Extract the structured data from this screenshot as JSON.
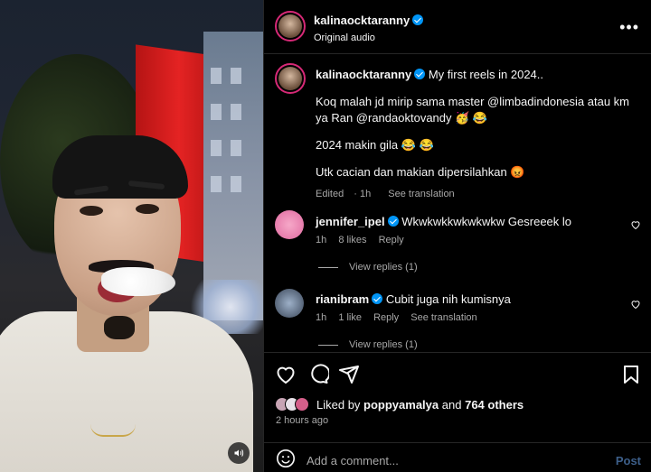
{
  "post_author": {
    "username": "kalinaocktaranny",
    "audio": "Original audio"
  },
  "caption": {
    "username": "kalinaocktaranny",
    "line1": "My first reels in 2024..",
    "line2": "Koq malah jd mirip sama master @limbadindonesia atau km ya Ran @randaoktovandy 🥳 😂",
    "line3": "2024 makin gila 😂 😂",
    "line4": "Utk cacian dan makian dipersilahkan 😡",
    "edited": "Edited",
    "time": "1h",
    "see_translation": "See translation"
  },
  "comments": [
    {
      "username": "jennifer_ipel",
      "text": "Wkwkwkkwkwkwkw Gesreeek lo",
      "time": "1h",
      "likes": "8 likes",
      "reply": "Reply",
      "view_replies": "View replies (1)"
    },
    {
      "username": "rianibram",
      "text": "Cubit juga nih kumisnya",
      "time": "1h",
      "likes": "1 like",
      "reply": "Reply",
      "see_translation": "See translation",
      "view_replies": "View replies (1)"
    }
  ],
  "likes": {
    "prefix": "Liked by",
    "user": "poppyamalya",
    "and": "and",
    "others": "764 others"
  },
  "timestamp": "2 hours ago",
  "add_comment": {
    "placeholder": "Add a comment...",
    "post_label": "Post"
  },
  "colors": {
    "verified": "#0095f6",
    "muted_text": "#a8a8a8",
    "post_button": "#3d5f8a"
  }
}
